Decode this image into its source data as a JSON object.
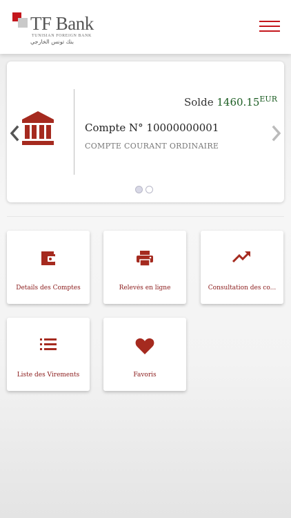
{
  "header": {
    "brand": "TF Bank",
    "tagline": "TUNISIAN FOREIGN BANK",
    "tagline_ar": "بنك تونس الخارجي",
    "menu_icon": "hamburger-icon"
  },
  "account": {
    "solde_label": "Solde",
    "balance": "1460.15",
    "currency": "EUR",
    "account_number": "Compte N° 10000000001",
    "account_type": "COMPTE COURANT ORDINAIRE",
    "pages": 2,
    "current_page": 1
  },
  "tiles": [
    {
      "label": "Details des Comptes",
      "icon": "wallet-icon"
    },
    {
      "label": "Relevés en ligne",
      "icon": "printer-icon"
    },
    {
      "label": "Consultation des co...",
      "icon": "trending-up-icon"
    },
    {
      "label": "Liste des Virements",
      "icon": "list-icon"
    },
    {
      "label": "Favoris",
      "icon": "heart-icon"
    }
  ],
  "colors": {
    "brand_red": "#c4161c",
    "icon_red": "#a52a1f",
    "balance_green": "#1a5c21"
  }
}
